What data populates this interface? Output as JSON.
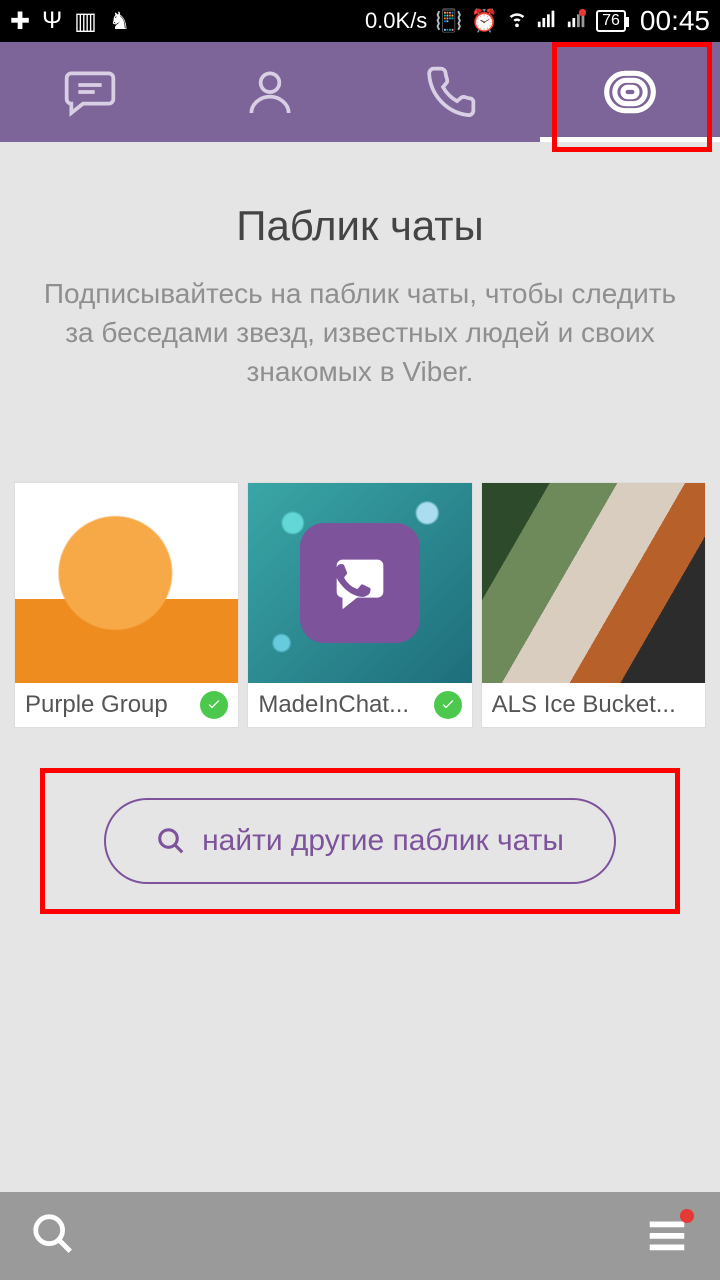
{
  "status": {
    "speed": "0.0K/s",
    "battery": "76",
    "time": "00:45"
  },
  "page": {
    "title": "Паблик чаты",
    "subtitle": "Подписывайтесь на паблик чаты, чтобы следить за беседами звезд, известных людей и своих знакомых в Viber."
  },
  "cards": [
    {
      "name": "Purple Group",
      "verified": true
    },
    {
      "name": "MadeInChat...",
      "verified": true
    },
    {
      "name": "ALS Ice Bucket...",
      "verified": false
    }
  ],
  "search_button": "найти другие паблик чаты",
  "colors": {
    "brand": "#7d6599",
    "accent": "#7d539c",
    "highlight": "#ff0000"
  }
}
